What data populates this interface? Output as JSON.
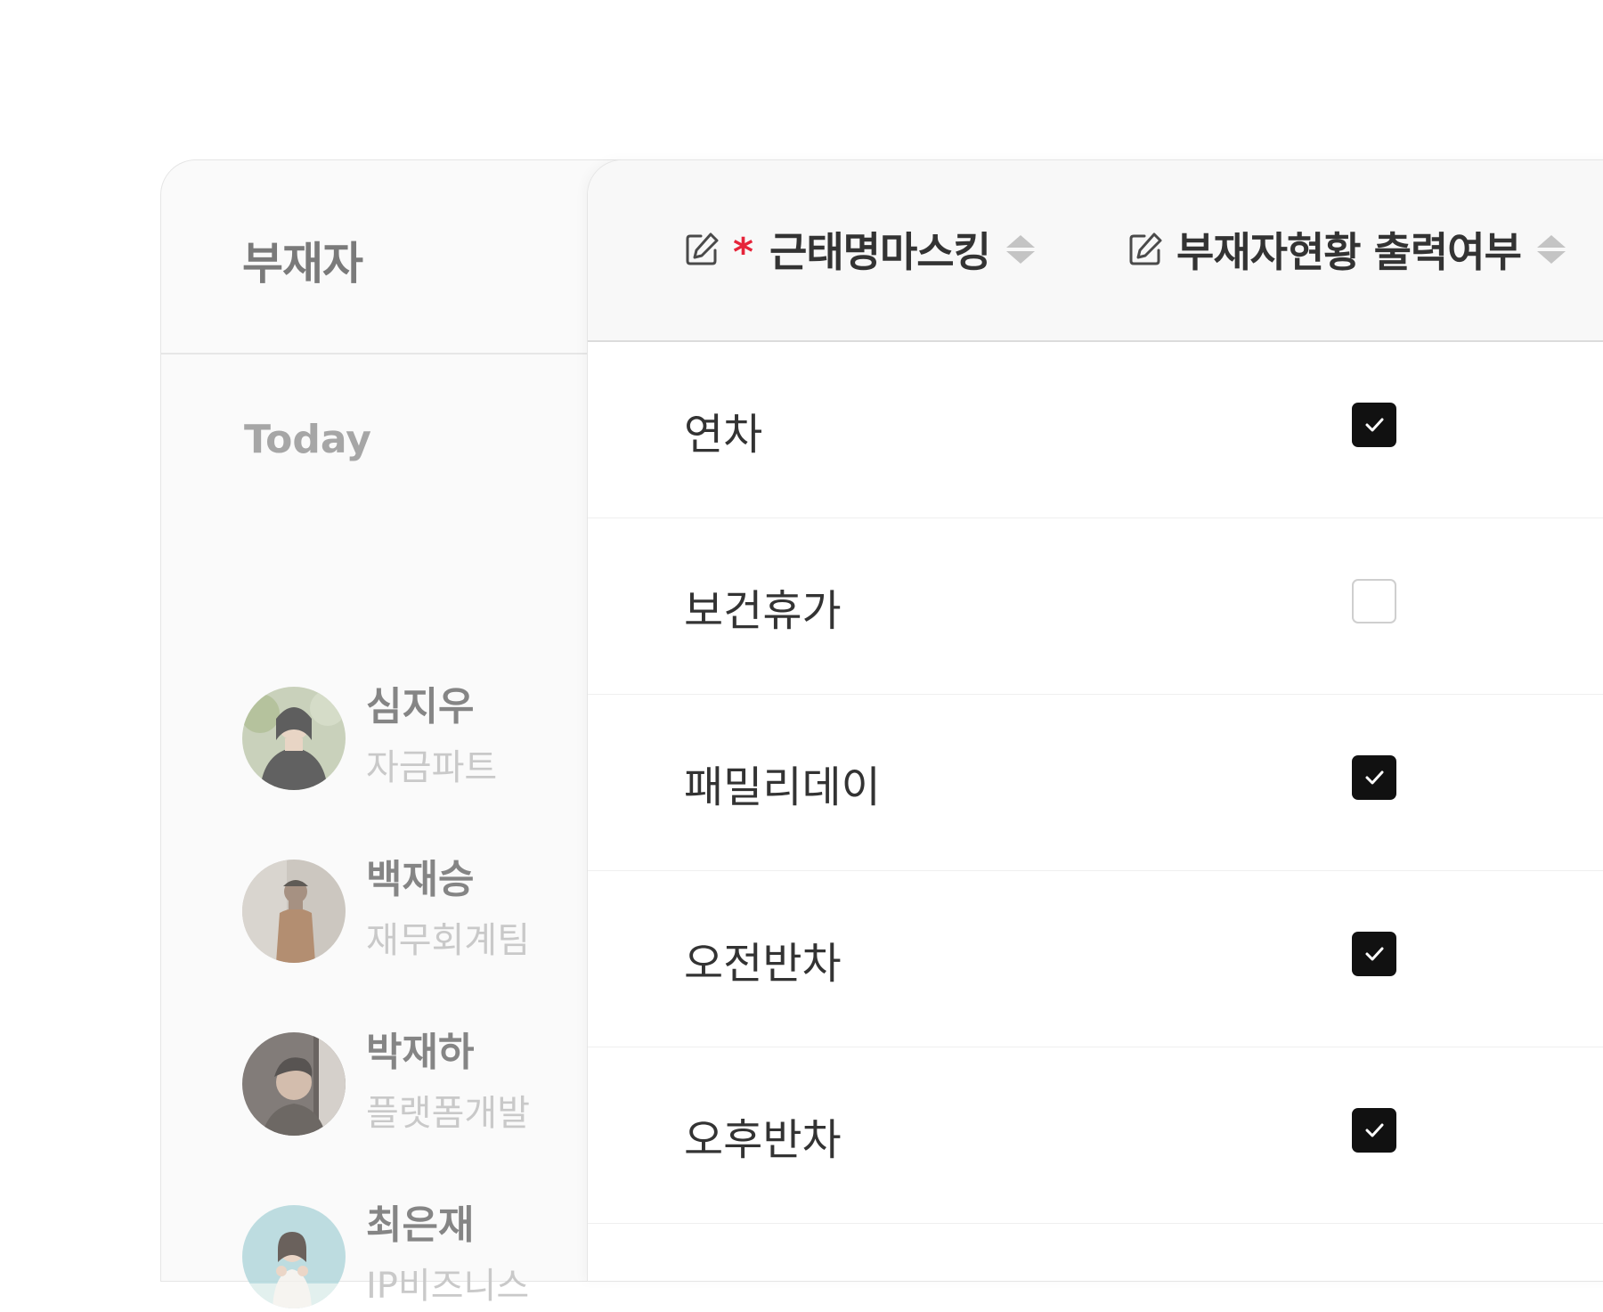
{
  "absentee_panel": {
    "title": "부재자",
    "section_label": "Today",
    "people": [
      {
        "name": "심지우",
        "team": "자금파트",
        "avatar": "woman-portrait-avatar"
      },
      {
        "name": "백재승",
        "team": "재무회계팀",
        "avatar": "man-standing-avatar"
      },
      {
        "name": "박재하",
        "team": "플랫폼개발",
        "avatar": "man-window-avatar"
      },
      {
        "name": "최은재",
        "team": "IP비즈니스",
        "avatar": "woman-sky-avatar"
      }
    ]
  },
  "table": {
    "columns": [
      {
        "title": "근태명마스킹",
        "required": true,
        "required_mark": "*",
        "icons": [
          "edit-icon",
          "sort-icon"
        ]
      },
      {
        "title": "부재자현황 출력여부",
        "required": false,
        "icons": [
          "edit-icon",
          "sort-icon"
        ]
      }
    ],
    "rows": [
      {
        "name": "연차",
        "show_in_absentee_status": true
      },
      {
        "name": "보건휴가",
        "show_in_absentee_status": false
      },
      {
        "name": "패밀리데이",
        "show_in_absentee_status": true
      },
      {
        "name": "오전반차",
        "show_in_absentee_status": true
      },
      {
        "name": "오후반차",
        "show_in_absentee_status": true
      }
    ]
  },
  "colors": {
    "required_mark": "#e6243a",
    "checkbox_checked": "#111111",
    "checkbox_unchecked_border": "#cfcfcf"
  }
}
